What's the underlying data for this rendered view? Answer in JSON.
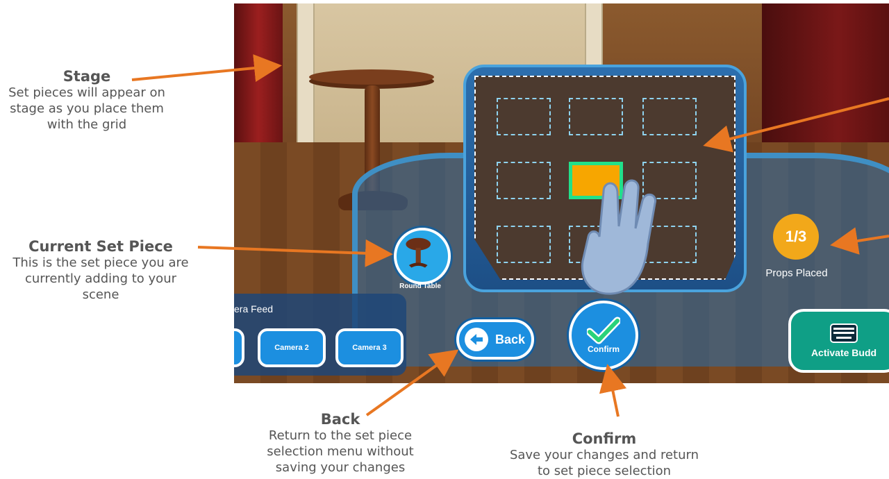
{
  "annotations": {
    "stage": {
      "title": "Stage",
      "desc": "Set pieces will appear on stage as you place them with the grid"
    },
    "current_set_piece": {
      "title": "Current Set Piece",
      "desc": "This is the set piece you are currently adding to your scene"
    },
    "back": {
      "title": "Back",
      "desc": "Return to the set piece selection menu without saving your changes"
    },
    "confirm": {
      "title": "Confirm",
      "desc": "Save your changes and return to set piece selection"
    }
  },
  "scene": {
    "current_piece": {
      "name": "Round Table",
      "icon": "round-table-icon"
    },
    "camera_panel": {
      "label": "era Feed",
      "buttons": [
        "Camera 2",
        "Camera 3"
      ]
    },
    "back_label": "Back",
    "confirm_label": "Confirm",
    "props": {
      "count": "1/3",
      "label": "Props Placed"
    },
    "buddy_label": "Activate Budd",
    "grid": {
      "rows": 3,
      "cols": 3,
      "selected_row": 1,
      "selected_col": 1
    }
  },
  "colors": {
    "annotation_arrow": "#e87722",
    "ui_blue": "#1c8fe0",
    "selected_cell": "#f7a600",
    "selected_border": "#22e08a",
    "props_badge": "#f2a81a",
    "buddy_button": "#0f9f86"
  }
}
